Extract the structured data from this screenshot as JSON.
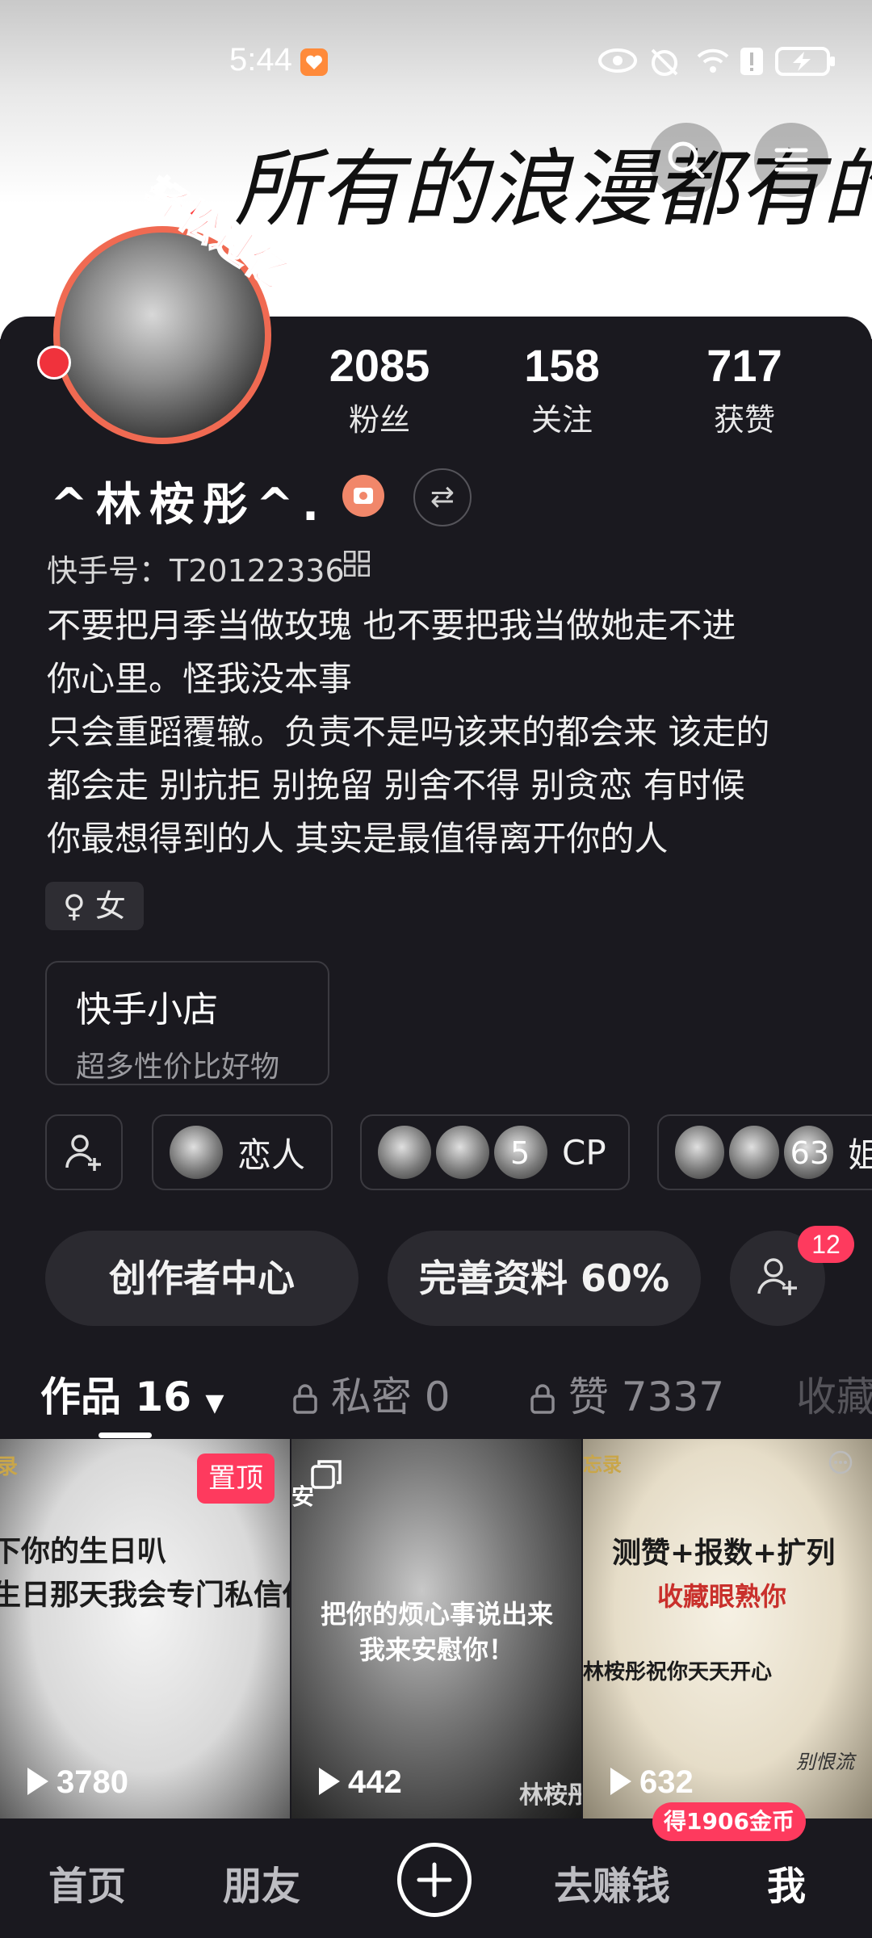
{
  "status_bar": {
    "time": "5:44"
  },
  "banner": {
    "text": "所有的浪漫都有的难忘"
  },
  "profile": {
    "avatar_badge": "轻松过亿",
    "name": "^林桉彤^.",
    "kuaishou_id": "快手号：T20122336",
    "bio": "不要把月季当做玫瑰   也不要把我当做她走不进\n你心里。怪我没本事\n只会重蹈覆辙。负责不是吗该来的都会来 该走的\n都会走 别抗拒 别挽留 别舍不得 别贪恋  有时候\n你最想得到的人 其实是最值得离开你的人",
    "gender": "女"
  },
  "stats": [
    {
      "value": "2085",
      "label": "粉丝"
    },
    {
      "value": "158",
      "label": "关注"
    },
    {
      "value": "717",
      "label": "获赞"
    }
  ],
  "shop": {
    "title": "快手小店",
    "subtitle": "超多性价比好物"
  },
  "relations": [
    {
      "label": "恋人"
    },
    {
      "count": "5",
      "label": "CP"
    },
    {
      "count": "63",
      "label": "姐"
    }
  ],
  "actions": {
    "creator_center": "创作者中心",
    "complete_profile": "完善资料 60%",
    "add_friend_badge": "12"
  },
  "tabs": [
    {
      "label": "作品 16"
    },
    {
      "label": "私密 0"
    },
    {
      "label": "赞 7337"
    },
    {
      "label": "收藏"
    }
  ],
  "works": [
    {
      "views": "3780",
      "pinned": "置顶",
      "line1": "下你的生日叭",
      "line2": "生日那天我会专门私信你",
      "corner": "录"
    },
    {
      "views": "442",
      "line1": "把你的烦心事说出来",
      "line2": "我来安慰你！",
      "corner": "安",
      "watermark": "林桉彤"
    },
    {
      "views": "632",
      "line1": "测赞+报数+扩列",
      "line2": "收藏眼熟你",
      "line3": "林桉彤祝你天天开心",
      "corner": "忘录",
      "signature": "别恨流"
    }
  ],
  "bottom_nav": {
    "home": "首页",
    "friends": "朋友",
    "earn": "去赚钱",
    "me": "我",
    "coin_badge": "得1906金币"
  },
  "colors": {
    "accent": "#fe3a5e",
    "background": "#1a191f"
  }
}
